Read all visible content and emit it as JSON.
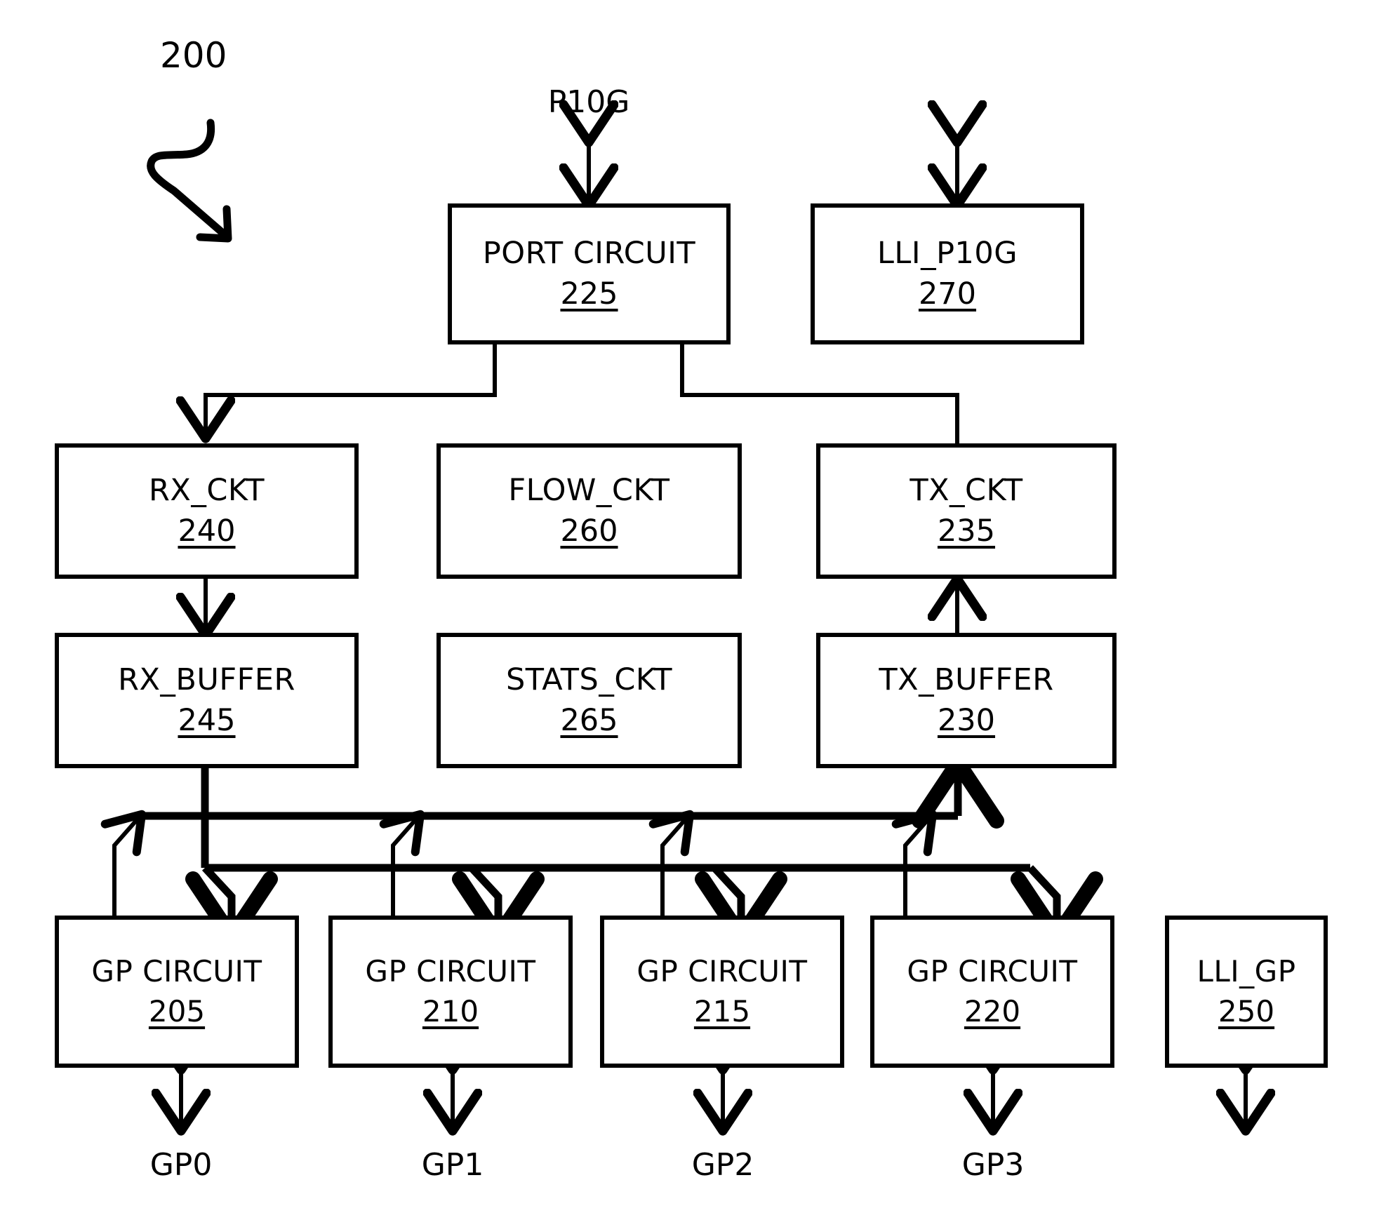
{
  "figure": {
    "reference_number": "200"
  },
  "signals": {
    "p10g": "P10G",
    "gp0": "GP0",
    "gp1": "GP1",
    "gp2": "GP2",
    "gp3": "GP3"
  },
  "blocks": [
    {
      "id": "port_circuit",
      "title": "PORT CIRCUIT",
      "number": "225"
    },
    {
      "id": "lli_p10g",
      "title": "LLI_P10G",
      "number": "270"
    },
    {
      "id": "rx_ckt",
      "title": "RX_CKT",
      "number": "240"
    },
    {
      "id": "flow_ckt",
      "title": "FLOW_CKT",
      "number": "260"
    },
    {
      "id": "tx_ckt",
      "title": "TX_CKT",
      "number": "235"
    },
    {
      "id": "rx_buffer",
      "title": "RX_BUFFER",
      "number": "245"
    },
    {
      "id": "stats_ckt",
      "title": "STATS_CKT",
      "number": "265"
    },
    {
      "id": "tx_buffer",
      "title": "TX_BUFFER",
      "number": "230"
    },
    {
      "id": "gp_circuit_0",
      "title": "GP CIRCUIT",
      "number": "205"
    },
    {
      "id": "gp_circuit_1",
      "title": "GP CIRCUIT",
      "number": "210"
    },
    {
      "id": "gp_circuit_2",
      "title": "GP CIRCUIT",
      "number": "215"
    },
    {
      "id": "gp_circuit_3",
      "title": "GP CIRCUIT",
      "number": "220"
    },
    {
      "id": "lli_gp",
      "title": "LLI_GP",
      "number": "250"
    }
  ],
  "colors": {
    "stroke": "#000000",
    "background": "#ffffff"
  }
}
